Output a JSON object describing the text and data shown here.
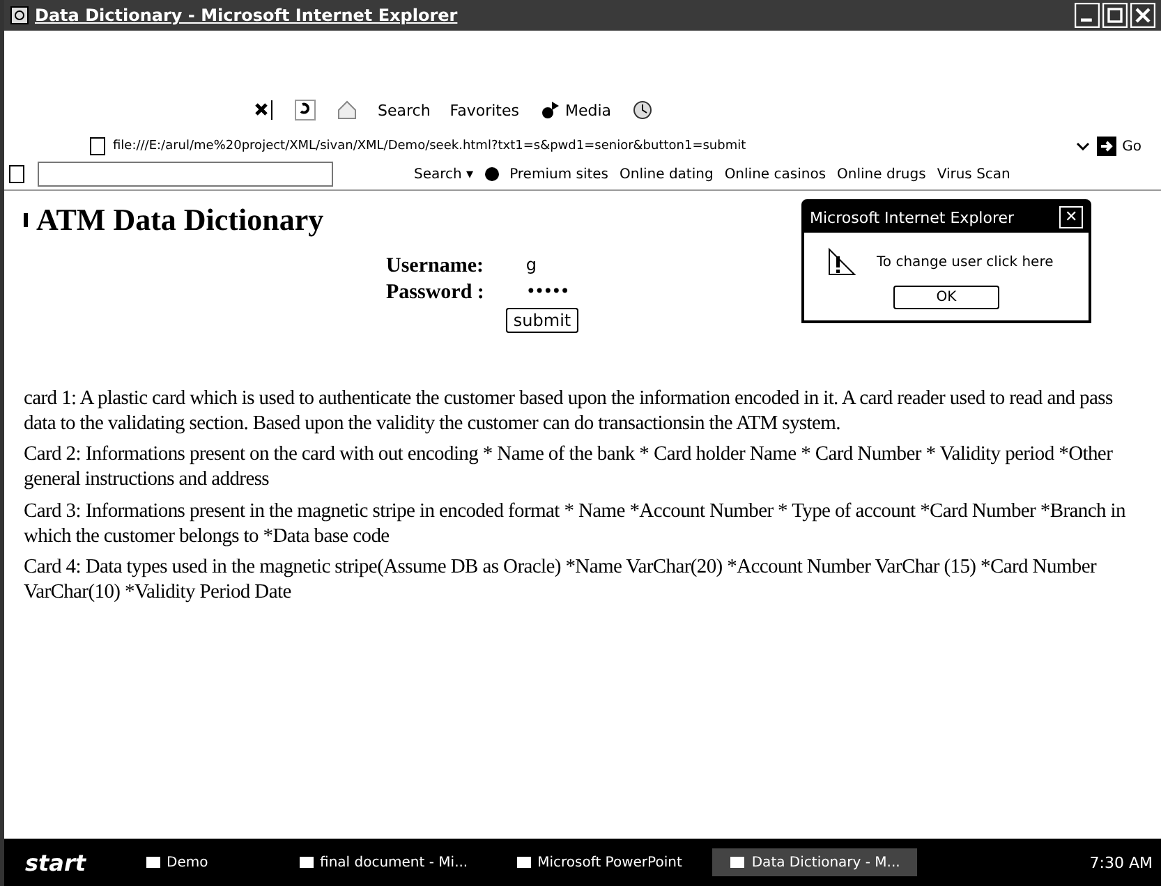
{
  "window": {
    "title": "Data Dictionary - Microsoft Internet Explorer"
  },
  "toolbar": {
    "buttons": [
      {
        "kind": "stop"
      },
      {
        "kind": "refresh"
      },
      {
        "kind": "home"
      },
      {
        "kind": "search",
        "label": "Search"
      },
      {
        "kind": "favorites",
        "label": "Favorites"
      },
      {
        "kind": "media",
        "label": "Media"
      },
      {
        "kind": "history"
      }
    ]
  },
  "address_bar": {
    "value": "file:///E:/arul/me%20project/XML/sivan/XML/Demo/seek.html?txt1=s&pwd1=senior&button1=submit",
    "go": "Go"
  },
  "links_bar": {
    "search": "Search ▾",
    "links": [
      "Premium sites",
      "Online dating",
      "Online casinos",
      "Online drugs",
      "Virus Scan"
    ]
  },
  "page": {
    "heading": "ATM Data Dictionary",
    "form": {
      "username_label": "Username:",
      "username_value": "g",
      "password_label": "Password :",
      "password_value": "•••••",
      "submit": "submit"
    },
    "paragraphs": [
      "card 1: A plastic card which is used to authenticate the customer based upon the information encoded in it. A card reader used to read and pass data to the validating section. Based upon the validity the customer can do transactionsin the ATM system.",
      "Card 2: Informations present on the card with out encoding * Name of the bank * Card holder Name * Card Number * Validity period *Other general instructions and address",
      "Card 3: Informations present in the magnetic stripe in encoded format * Name *Account Number * Type of account *Card Number *Branch in which the customer belongs to *Data base code",
      "Card 4: Data types used in the magnetic stripe(Assume DB as Oracle) *Name VarChar(20) *Account Number VarChar (15) *Card Number VarChar(10) *Validity Period Date"
    ]
  },
  "dialog": {
    "title": "Microsoft Internet Explorer",
    "close": "✕",
    "message": "To change user click here",
    "ok": "OK"
  },
  "taskbar": {
    "start": "start",
    "items": [
      {
        "label": "Demo",
        "selected": false
      },
      {
        "label": "final document - Mi...",
        "selected": false
      },
      {
        "label": "Microsoft PowerPoint",
        "selected": false
      },
      {
        "label": "Data Dictionary - M...",
        "selected": true
      }
    ],
    "clock": "7:30 AM"
  }
}
